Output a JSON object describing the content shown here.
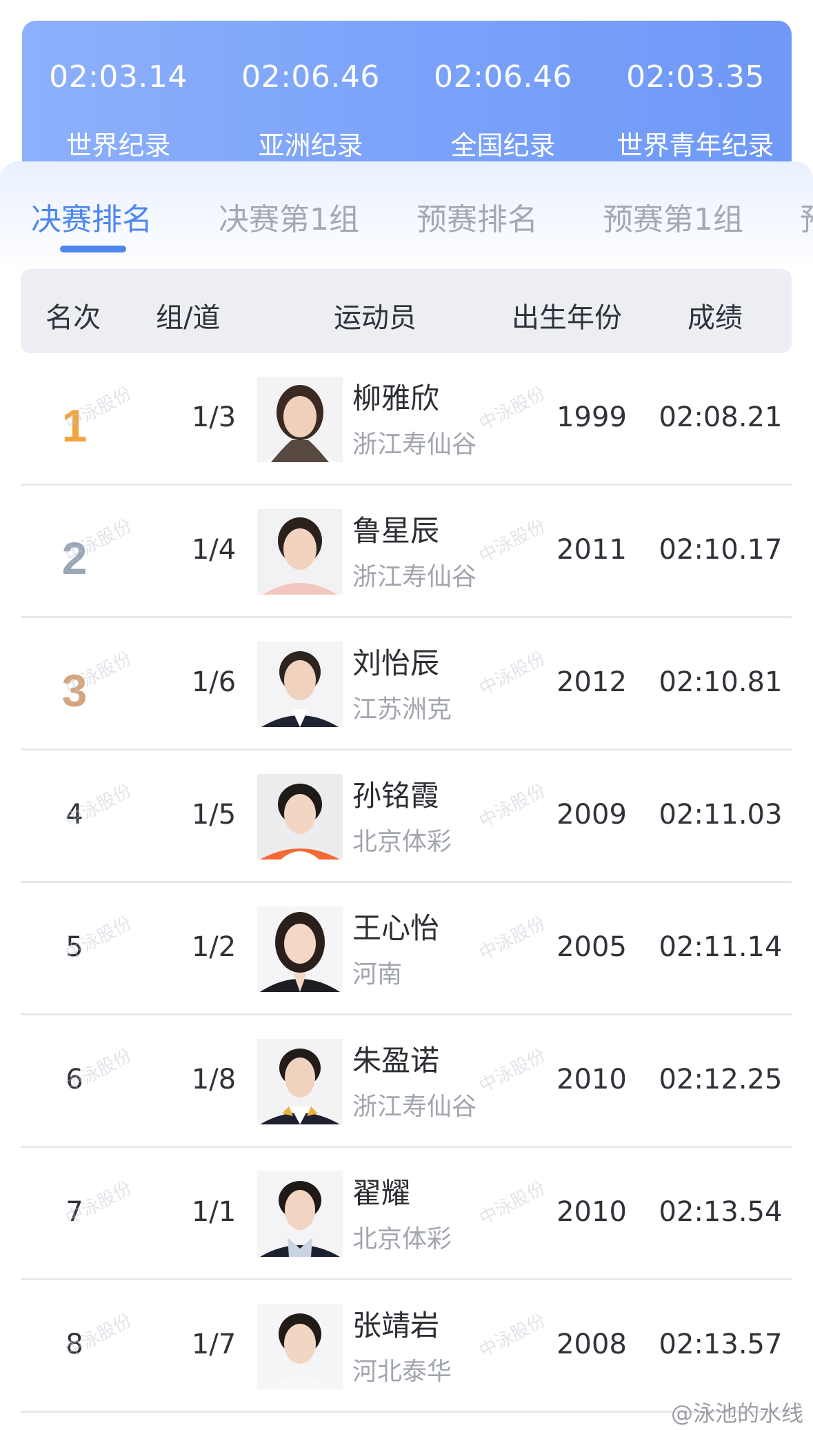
{
  "records": [
    {
      "time": "02:03.14",
      "label": "世界纪录"
    },
    {
      "time": "02:06.46",
      "label": "亚洲纪录"
    },
    {
      "time": "02:06.46",
      "label": "全国纪录"
    },
    {
      "time": "02:03.35",
      "label": "世界青年纪录"
    }
  ],
  "tabs": [
    {
      "label": "决赛排名",
      "active": true
    },
    {
      "label": "决赛第1组",
      "active": false
    },
    {
      "label": "预赛排名",
      "active": false
    },
    {
      "label": "预赛第1组",
      "active": false
    },
    {
      "label": "预",
      "active": false
    }
  ],
  "table": {
    "headers": {
      "rank": "名次",
      "lane": "组/道",
      "athlete": "运动员",
      "birth_year": "出生年份",
      "result": "成绩"
    },
    "rows": [
      {
        "rank": "1",
        "lane": "1/3",
        "name": "柳雅欣",
        "club": "浙江寿仙谷",
        "year": "1999",
        "result": "02:08.21"
      },
      {
        "rank": "2",
        "lane": "1/4",
        "name": "鲁星辰",
        "club": "浙江寿仙谷",
        "year": "2011",
        "result": "02:10.17"
      },
      {
        "rank": "3",
        "lane": "1/6",
        "name": "刘怡辰",
        "club": "江苏洲克",
        "year": "2012",
        "result": "02:10.81"
      },
      {
        "rank": "4",
        "lane": "1/5",
        "name": "孙铭霞",
        "club": "北京体彩",
        "year": "2009",
        "result": "02:11.03"
      },
      {
        "rank": "5",
        "lane": "1/2",
        "name": "王心怡",
        "club": "河南",
        "year": "2005",
        "result": "02:11.14"
      },
      {
        "rank": "6",
        "lane": "1/8",
        "name": "朱盈诺",
        "club": "浙江寿仙谷",
        "year": "2010",
        "result": "02:12.25"
      },
      {
        "rank": "7",
        "lane": "1/1",
        "name": "翟耀",
        "club": "北京体彩",
        "year": "2010",
        "result": "02:13.54"
      },
      {
        "rank": "8",
        "lane": "1/7",
        "name": "张靖岩",
        "club": "河北泰华",
        "year": "2008",
        "result": "02:13.57"
      }
    ]
  },
  "watermark": {
    "text": "中泳股份"
  },
  "footer": {
    "weibo": "@泳池的水线"
  },
  "colors": {
    "accent": "#4d86ee",
    "banner_start": "#8db0fb",
    "banner_end": "#6f98f7",
    "gold": "#f2a43a",
    "silver": "#9aa7b8",
    "bronze": "#d6a57e"
  }
}
